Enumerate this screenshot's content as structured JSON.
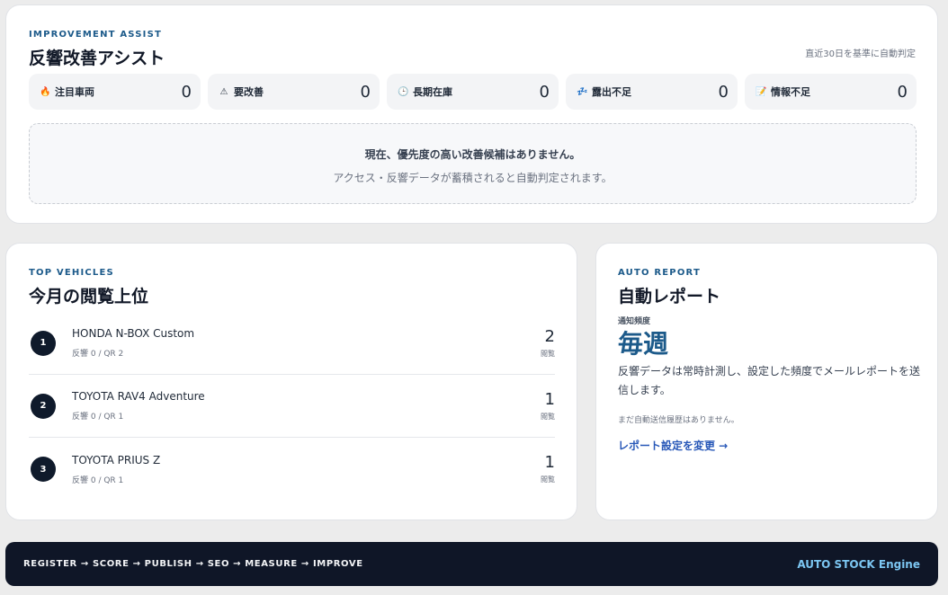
{
  "improve": {
    "eyebrow": "IMPROVEMENT ASSIST",
    "title": "反響改善アシスト",
    "note": "直近30日を基準に自動判定",
    "stats": [
      {
        "icon": "🔥",
        "icon_name": "fire-icon",
        "label": "注目車両",
        "value": "0"
      },
      {
        "icon": "⚠",
        "icon_name": "warning-icon",
        "label": "要改善",
        "value": "0"
      },
      {
        "icon": "🕒",
        "icon_name": "clock-icon",
        "label": "長期在庫",
        "value": "0"
      },
      {
        "icon": "💤",
        "icon_name": "sleep-icon",
        "label": "露出不足",
        "value": "0"
      },
      {
        "icon": "📝",
        "icon_name": "memo-icon",
        "label": "情報不足",
        "value": "0"
      }
    ],
    "empty_title": "現在、優先度の高い改善候補はありません。",
    "empty_sub": "アクセス・反響データが蓄積されると自動判定されます。"
  },
  "vehicles": {
    "eyebrow": "TOP VEHICLES",
    "title": "今月の閲覧上位",
    "items": [
      {
        "rank": "1",
        "name": "HONDA N-BOX Custom",
        "meta": "反響 0 / QR 2",
        "count": "2",
        "unit": "閲覧"
      },
      {
        "rank": "2",
        "name": "TOYOTA RAV4 Adventure",
        "meta": "反響 0 / QR 1",
        "count": "1",
        "unit": "閲覧"
      },
      {
        "rank": "3",
        "name": "TOYOTA PRIUS Z",
        "meta": "反響 0 / QR 1",
        "count": "1",
        "unit": "閲覧"
      }
    ]
  },
  "report": {
    "eyebrow": "AUTO REPORT",
    "title": "自動レポート",
    "freq_label": "通知頻度",
    "freq_value": "毎週",
    "description": "反響データは常時計測し、設定した頻度でメールレポートを送信します。",
    "note": "まだ自動送信履歴はありません。",
    "link": "レポート設定を変更 →"
  },
  "footer": {
    "flow": "REGISTER → SCORE → PUBLISH → SEO → MEASURE → IMPROVE",
    "engine": "AUTO STOCK Engine"
  },
  "colors": {
    "accent": "#1c5a8a",
    "link": "#2858b8",
    "footer_bg": "#0f1627",
    "engine": "#7cc6f2"
  }
}
